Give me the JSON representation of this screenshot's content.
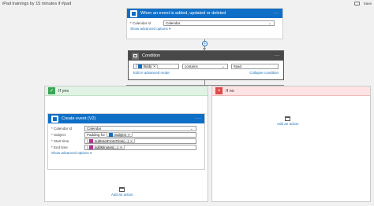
{
  "window": {
    "title": "iPad trainings by 15 minutes if #pad"
  },
  "toolbar": {
    "right_label": "Save"
  },
  "trigger": {
    "title": "When an event is added, updated or deleted",
    "more": "···",
    "calendar_label": "* Calendar id",
    "calendar_value": "Calendar",
    "advanced_link": "Show advanced options ▾"
  },
  "connector": {
    "plus": "+"
  },
  "condition": {
    "title": "Condition",
    "more": "···",
    "token_label": "Body",
    "token_remove": "×",
    "operator": "contains",
    "value": "#pad",
    "edit_advanced": "Edit in advanced mode",
    "collapse": "Collapse condition"
  },
  "if_yes": {
    "title": "If yes",
    "check": "✓",
    "action": {
      "title": "Create event (V2)",
      "more": "···",
      "rows": [
        {
          "label": "* Calendar id",
          "value": "Calendar"
        },
        {
          "label": "* Subject",
          "prefix": "Padding for",
          "token": "Subject"
        },
        {
          "label": "* Start time",
          "token": "subtractFromTime(...)"
        },
        {
          "label": "* End time",
          "token": "addMinutes(...)"
        }
      ],
      "advanced_link": "Show advanced options ▾"
    },
    "add_action": "Add an action"
  },
  "if_no": {
    "title": "If no",
    "xmark": "×",
    "add_action": "Add an action"
  },
  "colors": {
    "outlook_blue": "#0f6fc6",
    "condition_gray": "#484848",
    "yes_green": "#3aa655",
    "no_red": "#e04848",
    "link": "#1c6eb4"
  }
}
